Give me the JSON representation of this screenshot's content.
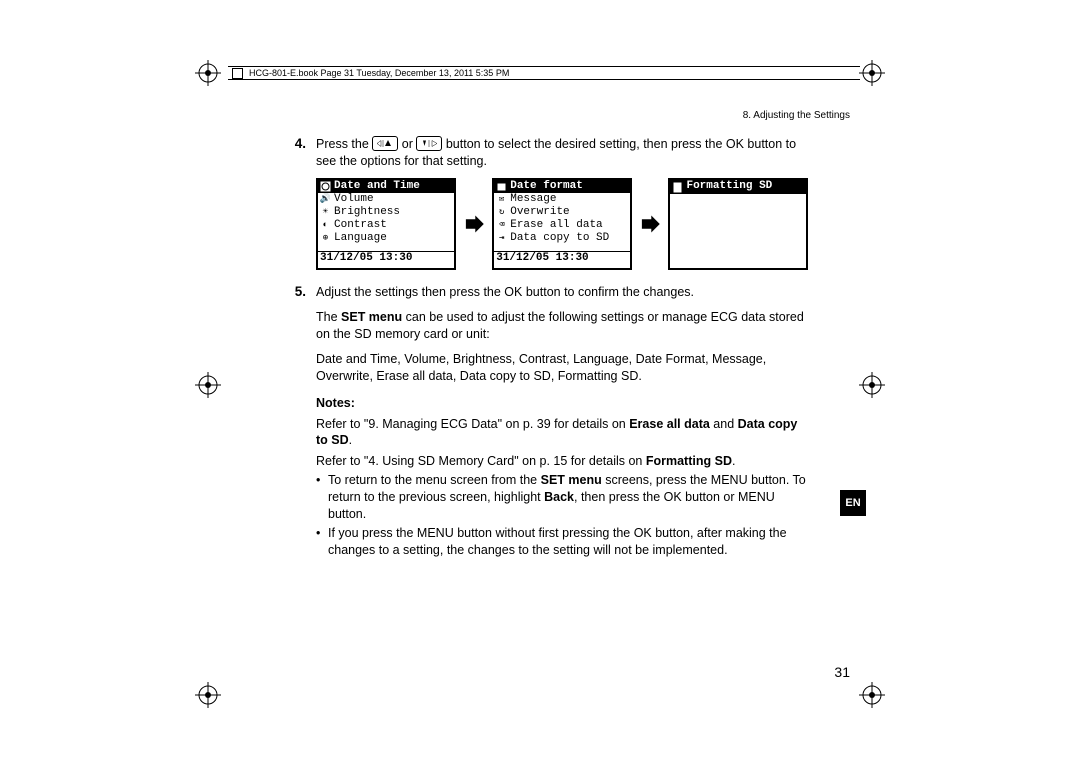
{
  "header": {
    "text": "HCG-801-E.book  Page 31  Tuesday, December 13, 2011  5:35 PM"
  },
  "section_title": "8. Adjusting the Settings",
  "step4": {
    "num": "4.",
    "pre": "Press the ",
    "mid": " or ",
    "post": " button to select the desired setting, then press the OK button to see the options for that setting."
  },
  "screens": {
    "s1": {
      "title": "Date and Time",
      "rows": [
        "Volume",
        "Brightness",
        "Contrast",
        "Language"
      ],
      "footer": "31/12/05 13:30"
    },
    "s2": {
      "title": "Date format",
      "rows": [
        "Message",
        "Overwrite",
        "Erase all data",
        "Data copy to SD"
      ],
      "footer": "31/12/05 13:30"
    },
    "s3": {
      "title": "Formatting SD",
      "rows": [],
      "footer": ""
    }
  },
  "step5": {
    "num": "5.",
    "line1": "Adjust the settings then press the OK button to confirm the changes.",
    "line2_pre": "The ",
    "line2_bold": "SET menu",
    "line2_post": " can be used to adjust the following settings or manage ECG data stored on the SD memory card or unit:",
    "line3": "Date and Time, Volume, Brightness, Contrast, Language, Date Format, Message, Overwrite, Erase all data, Data copy to SD, Formatting SD."
  },
  "notes": {
    "head": "Notes:",
    "n1_pre": "Refer to \"9. Managing ECG Data\" on p. 39 for details on ",
    "n1_b1": "Erase all data",
    "n1_mid": " and ",
    "n1_b2": "Data copy to SD",
    "n1_post": ".",
    "n2_pre": "Refer to \"4. Using SD Memory Card\" on p. 15 for details on ",
    "n2_b": "Formatting SD",
    "n2_post": ".",
    "b1_pre": "To return to the menu screen from the ",
    "b1_bold1": "SET menu",
    "b1_mid": " screens, press the MENU button. To return to the previous screen, highlight ",
    "b1_bold2": "Back",
    "b1_post": ", then press the OK button or MENU button.",
    "b2": "If you press the MENU button without first pressing the OK button, after making the changes to a setting, the changes to the setting will not be implemented."
  },
  "en_badge": "EN",
  "page_num": "31"
}
